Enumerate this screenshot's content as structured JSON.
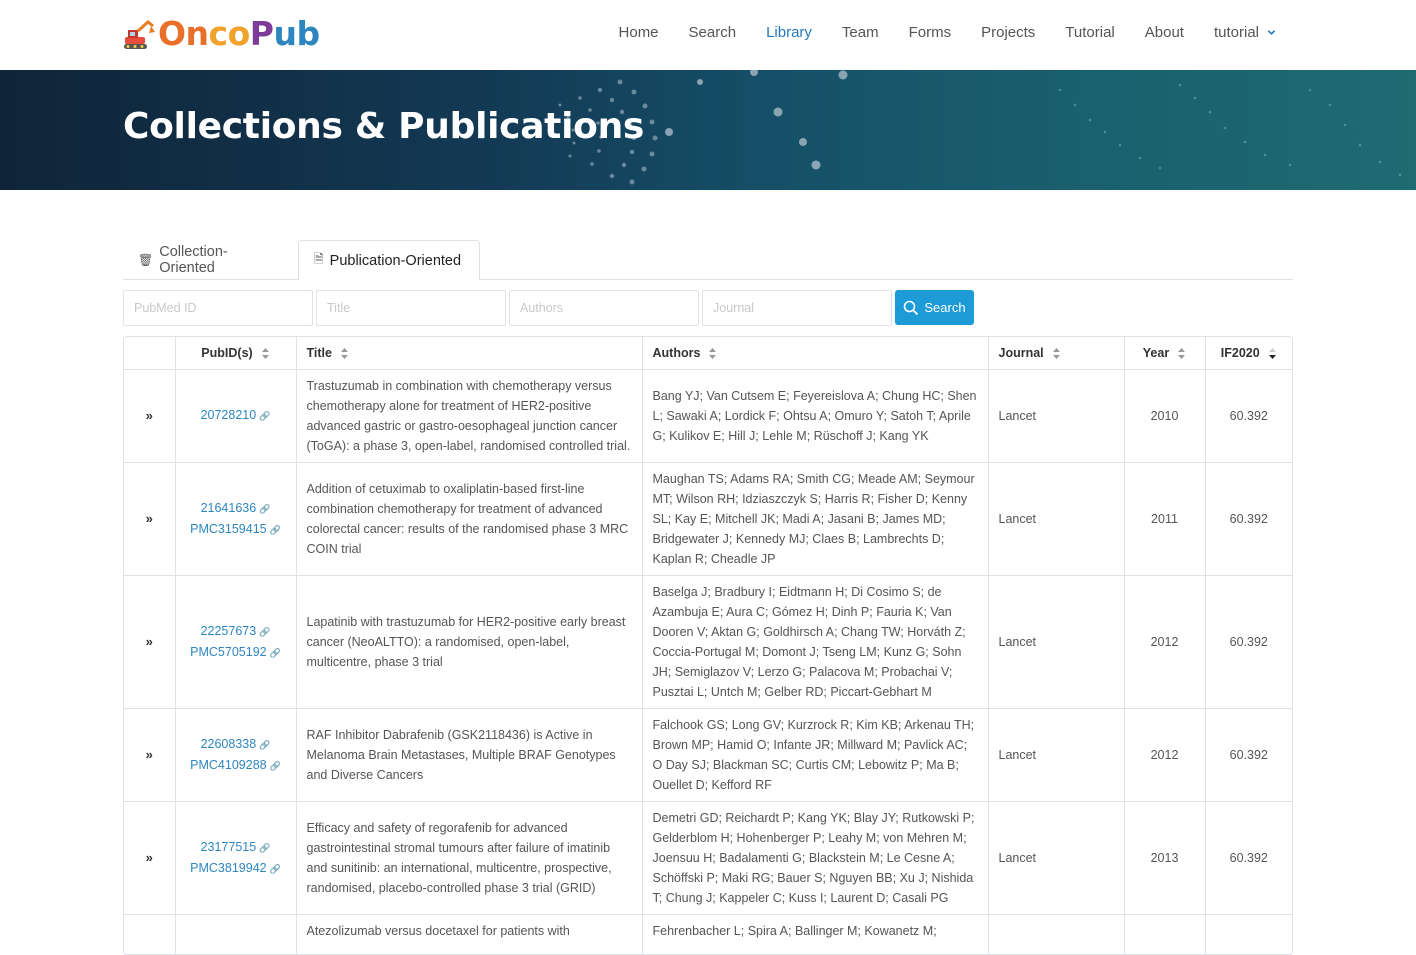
{
  "brand": {
    "logo_parts": [
      "On",
      "co",
      "P",
      "ub"
    ],
    "logo_icon": "excavator-icon"
  },
  "nav": {
    "items": [
      "Home",
      "Search",
      "Library",
      "Team",
      "Forms",
      "Projects",
      "Tutorial",
      "About"
    ],
    "active": "Library",
    "user_menu": "tutorial"
  },
  "banner": {
    "title": "Collections & Publications"
  },
  "tabs": [
    {
      "label": "Collection-Oriented",
      "icon": "archive-icon",
      "active": false
    },
    {
      "label": "Publication-Oriented",
      "icon": "document-icon",
      "active": true
    }
  ],
  "search": {
    "placeholders": [
      "PubMed ID",
      "Title",
      "Authors",
      "Journal"
    ],
    "button_label": "Search"
  },
  "table": {
    "columns": [
      "",
      "PubID(s)",
      "Title",
      "Authors",
      "Journal",
      "Year",
      "IF2020"
    ],
    "sorted_column": "IF2020",
    "rows": [
      {
        "pubids": [
          "20728210"
        ],
        "title": "Trastuzumab in combination with chemotherapy versus chemotherapy alone for treatment of HER2-positive advanced gastric or gastro-oesophageal junction cancer (ToGA): a phase 3, open-label, randomised controlled trial.",
        "authors": "Bang YJ; Van Cutsem E; Feyereislova A; Chung HC; Shen L; Sawaki A; Lordick F; Ohtsu A; Omuro Y; Satoh T; Aprile G; Kulikov E; Hill J; Lehle M; Rüschoff J; Kang YK",
        "journal": "Lancet",
        "year": "2010",
        "if2020": "60.392"
      },
      {
        "pubids": [
          "21641636",
          "PMC3159415"
        ],
        "title": "Addition of cetuximab to oxaliplatin-based first-line combination chemotherapy for treatment of advanced colorectal cancer: results of the randomised phase 3 MRC COIN trial",
        "authors": "Maughan TS; Adams RA; Smith CG; Meade AM; Seymour MT; Wilson RH; Idziaszczyk S; Harris R; Fisher D; Kenny SL; Kay E; Mitchell JK; Madi A; Jasani B; James MD; Bridgewater J; Kennedy MJ; Claes B; Lambrechts D; Kaplan R; Cheadle JP",
        "journal": "Lancet",
        "year": "2011",
        "if2020": "60.392"
      },
      {
        "pubids": [
          "22257673",
          "PMC5705192"
        ],
        "title": "Lapatinib with trastuzumab for HER2-positive early breast cancer (NeoALTTO): a randomised, open-label, multicentre, phase 3 trial",
        "authors": "Baselga J; Bradbury I; Eidtmann H; Di Cosimo S; de Azambuja E; Aura C; Gómez H; Dinh P; Fauria K; Van Dooren V; Aktan G; Goldhirsch A; Chang TW; Horváth Z; Coccia-Portugal M; Domont J; Tseng LM; Kunz G; Sohn JH; Semiglazov V; Lerzo G; Palacova M; Probachai V; Pusztai L; Untch M; Gelber RD; Piccart-Gebhart M",
        "journal": "Lancet",
        "year": "2012",
        "if2020": "60.392"
      },
      {
        "pubids": [
          "22608338",
          "PMC4109288"
        ],
        "title": "RAF Inhibitor Dabrafenib (GSK2118436) is Active in Melanoma Brain Metastases, Multiple BRAF Genotypes and Diverse Cancers",
        "authors": "Falchook GS; Long GV; Kurzrock R; Kim KB; Arkenau TH; Brown MP; Hamid O; Infante JR; Millward M; Pavlick AC; O Day SJ; Blackman SC; Curtis CM; Lebowitz P; Ma B; Ouellet D; Kefford RF",
        "journal": "Lancet",
        "year": "2012",
        "if2020": "60.392"
      },
      {
        "pubids": [
          "23177515",
          "PMC3819942"
        ],
        "title": "Efficacy and safety of regorafenib for advanced gastrointestinal stromal tumours after failure of imatinib and sunitinib: an international, multicentre, prospective, randomised, placebo-controlled phase 3 trial (GRID)",
        "authors": "Demetri GD; Reichardt P; Kang YK; Blay JY; Rutkowski P; Gelderblom H; Hohenberger P; Leahy M; von Mehren M; Joensuu H; Badalamenti G; Blackstein M; Le Cesne A; Schöffski P; Maki RG; Bauer S; Nguyen BB; Xu J; Nishida T; Chung J; Kappeler C; Kuss I; Laurent D; Casali PG",
        "journal": "Lancet",
        "year": "2013",
        "if2020": "60.392"
      },
      {
        "pubids": [
          ""
        ],
        "title": "Atezolizumab versus docetaxel for patients with",
        "authors": "Fehrenbacher L; Spira A; Ballinger M; Kowanetz M;",
        "journal": "",
        "year": "",
        "if2020": ""
      }
    ]
  }
}
